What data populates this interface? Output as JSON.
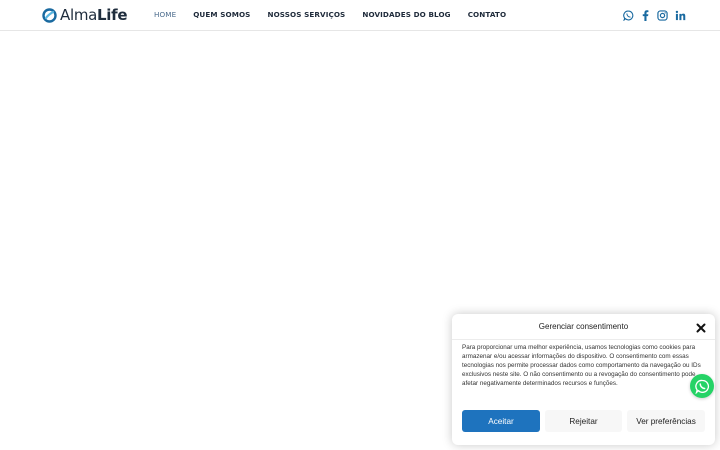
{
  "brand": {
    "logo_light": "Alma",
    "logo_bold": "Life",
    "accent_color": "#1a6aa0",
    "logo_color": "#1f2d3d"
  },
  "nav": {
    "items": [
      {
        "label": "HOME",
        "active": true
      },
      {
        "label": "QUEM SOMOS",
        "active": false
      },
      {
        "label": "NOSSOS SERVIÇOS",
        "active": false
      },
      {
        "label": "NOVIDADES DO BLOG",
        "active": false
      },
      {
        "label": "CONTATO",
        "active": false
      }
    ]
  },
  "social": {
    "icons": [
      "whatsapp-icon",
      "facebook-icon",
      "instagram-icon",
      "linkedin-icon"
    ]
  },
  "consent": {
    "title": "Gerenciar consentimento",
    "body": "Para proporcionar uma melhor experiência, usamos tecnologias como cookies para armazenar e/ou acessar informações do dispositivo. O consentimento com essas tecnologias nos permite processar dados como comportamento da navegação ou IDs exclusivos neste site. O não consentimento ou a revogação do consentimento pode afetar negativamente determinados recursos e funções.",
    "accept_label": "Aceitar",
    "reject_label": "Rejeitar",
    "prefs_label": "Ver preferências",
    "accept_color": "#1e73be"
  },
  "floating": {
    "whatsapp_color": "#25d366"
  }
}
